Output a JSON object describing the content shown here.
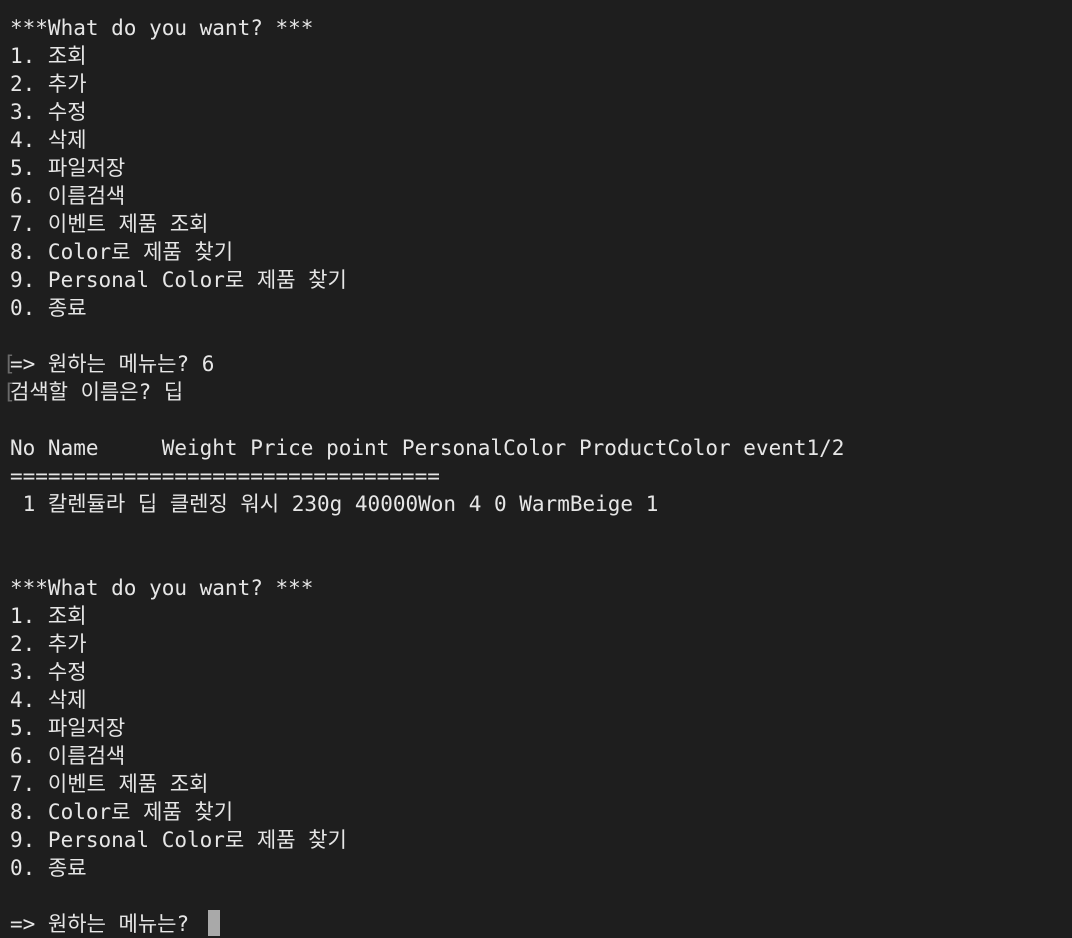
{
  "terminal": {
    "lines": [
      "***What do you want? ***",
      "1. 조회",
      "2. 추가",
      "3. 수정",
      "4. 삭제",
      "5. 파일저장",
      "6. 이름검색",
      "7. 이벤트 제품 조회",
      "8. Color로 제품 찾기",
      "9. Personal Color로 제품 찾기",
      "0. 종료",
      "",
      "=> 원하는 메뉴는? 6",
      "검색할 이름은? 딥",
      "",
      "No Name     Weight Price point PersonalColor ProductColor event1/2",
      "==================================",
      " 1 칼렌듈라 딥 클렌징 워시 230g 40000Won 4 0 WarmBeige 1",
      "",
      "",
      "***What do you want? ***",
      "1. 조회",
      "2. 추가",
      "3. 수정",
      "4. 삭제",
      "5. 파일저장",
      "6. 이름검색",
      "7. 이벤트 제품 조회",
      "8. Color로 제품 찾기",
      "9. Personal Color로 제품 찾기",
      "0. 종료",
      "",
      "=> 원하는 메뉴는? "
    ],
    "colors": {
      "background": "#1e1e1e",
      "text": "#e6e6e6",
      "cursor": "#a9a9a9",
      "mark": "#6a6a6a"
    }
  }
}
